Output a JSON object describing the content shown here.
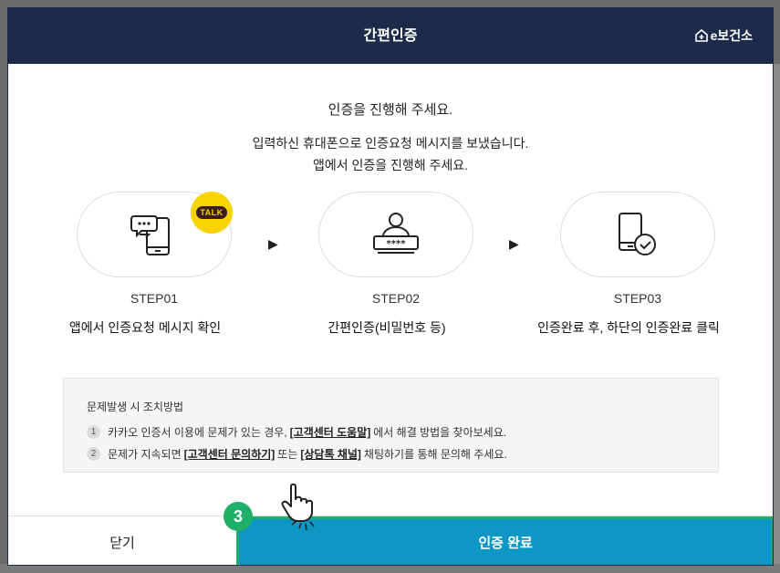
{
  "header": {
    "title": "간편인증",
    "brand": "e보건소"
  },
  "intro": {
    "line1": "인증을 진행해 주세요.",
    "line2": "입력하신 휴대폰으로 인증요청 메시지를 보냈습니다.",
    "line3": "앱에서 인증을 진행해 주세요."
  },
  "talk_badge": "TALK",
  "arrow_glyph": "▶",
  "steps": [
    {
      "title": "STEP01",
      "desc": "앱에서 인증요청 메시지 확인",
      "icon": "phone-chat-icon"
    },
    {
      "title": "STEP02",
      "desc": "간편인증(비밀번호 등)",
      "icon": "user-password-icon"
    },
    {
      "title": "STEP03",
      "desc": "인증완료 후, 하단의 인증완료 클릭",
      "icon": "phone-check-icon"
    }
  ],
  "notice": {
    "title": "문제발생 시 조치방법",
    "item1": {
      "num": "1",
      "pre": "카카오 인증서 이용에 문제가 있는 경우,",
      "link": "[고객센터 도움말]",
      "post": "에서 해결 방법을 찾아보세요."
    },
    "item2": {
      "num": "2",
      "pre": "문제가 지속되면",
      "link1": "[고객센터 문의하기]",
      "mid": "또는",
      "link2": "[상담톡 채널]",
      "post": "채팅하기를 통해 문의해 주세요."
    }
  },
  "footer": {
    "close_label": "닫기",
    "confirm_label": "인증 완료"
  },
  "step_marker": "3",
  "colors": {
    "header_bg": "#1c2b4a",
    "confirm_bg": "#0e97c4",
    "highlight": "#1db066",
    "kakao_yellow": "#f7d300"
  }
}
